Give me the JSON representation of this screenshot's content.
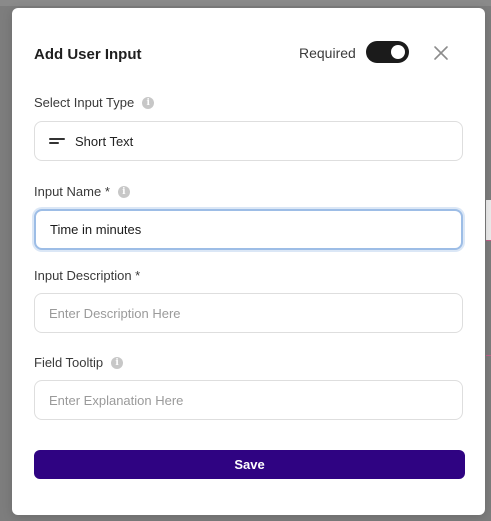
{
  "modal": {
    "title": "Add User Input",
    "required_label": "Required",
    "required_on": true
  },
  "fields": {
    "input_type": {
      "label": "Select Input Type",
      "value": "Short Text",
      "icon": "short-text-icon"
    },
    "input_name": {
      "label": "Input Name *",
      "value": "Time in minutes"
    },
    "input_description": {
      "label": "Input Description *",
      "placeholder": "Enter Description Here"
    },
    "field_tooltip": {
      "label": "Field Tooltip",
      "placeholder": "Enter Explanation Here"
    }
  },
  "save_label": "Save",
  "colors": {
    "primary": "#2f0382",
    "toggle_on": "#1b1b1b",
    "focus_border": "#9dbde6"
  }
}
